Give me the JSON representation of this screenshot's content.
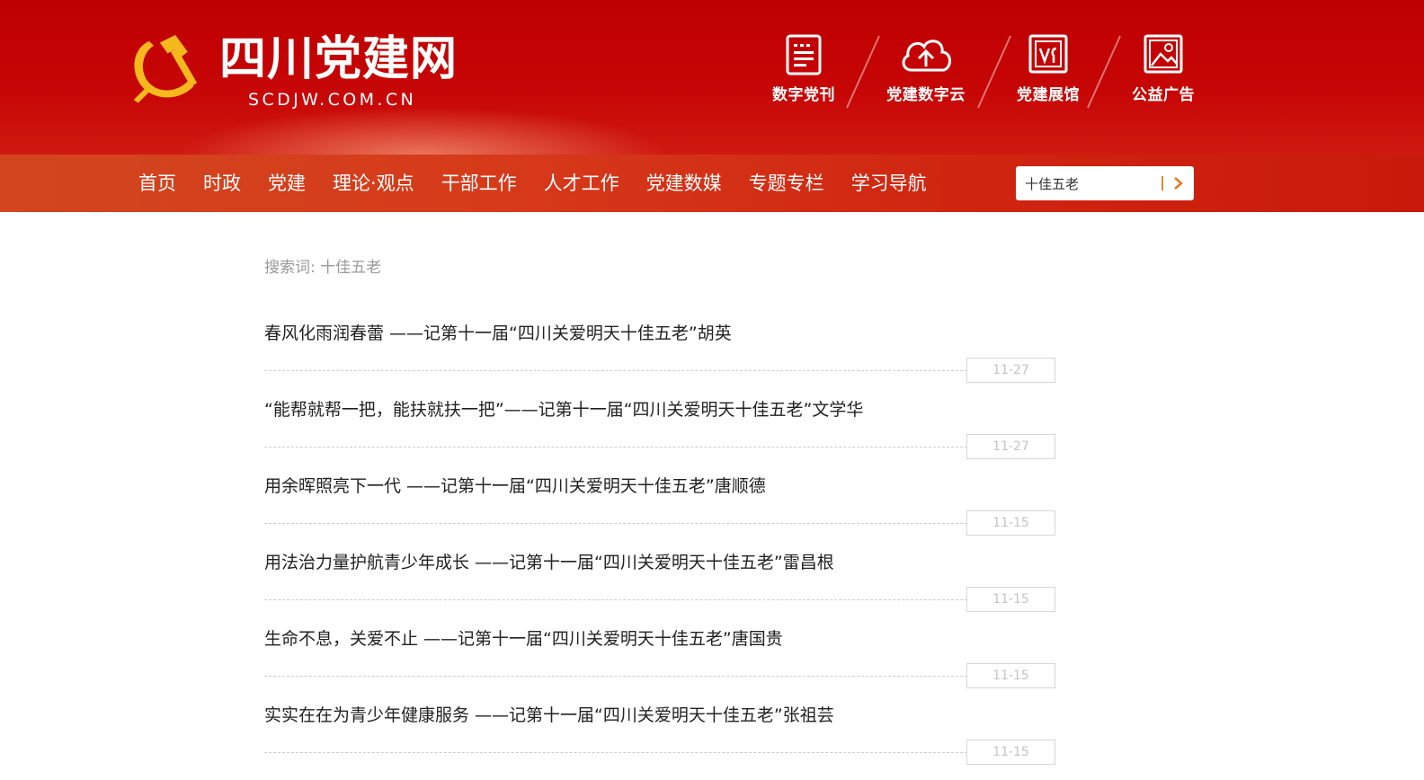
{
  "site": {
    "title_cn": "四川党建网",
    "title_en": "SCDJW.COM.CN"
  },
  "colors": {
    "header_red": "#c40404",
    "nav_orange_red": "#d43a1a",
    "emblem_gold": "#f5b91e",
    "date_text": "#c4c4c4"
  },
  "quick_links": [
    {
      "label": "数字党刊",
      "icon": "digital-journal-icon"
    },
    {
      "label": "党建数字云",
      "icon": "cloud-upload-icon"
    },
    {
      "label": "党建展馆",
      "icon": "exhibition-hall-icon"
    },
    {
      "label": "公益广告",
      "icon": "image-ad-icon"
    }
  ],
  "nav": {
    "items": [
      "首页",
      "时政",
      "党建",
      "理论·观点",
      "干部工作",
      "人才工作",
      "党建数媒",
      "专题专栏",
      "学习导航"
    ]
  },
  "search": {
    "value": "十佳五老",
    "button_icon": "chevron-right-icon"
  },
  "results": {
    "search_term_label": "搜索词: 十佳五老",
    "items": [
      {
        "title": "春风化雨润春蕾 ——记第十一届“四川关爱明天十佳五老”胡英",
        "date": "11-27"
      },
      {
        "title": "“能帮就帮一把，能扶就扶一把”——记第十一届“四川关爱明天十佳五老”文学华",
        "date": "11-27"
      },
      {
        "title": "用余晖照亮下一代 ——记第十一届“四川关爱明天十佳五老”唐顺德",
        "date": "11-15"
      },
      {
        "title": "用法治力量护航青少年成长 ——记第十一届“四川关爱明天十佳五老”雷昌根",
        "date": "11-15"
      },
      {
        "title": "生命不息，关爱不止 ——记第十一届“四川关爱明天十佳五老”唐国贵",
        "date": "11-15"
      },
      {
        "title": "实实在在为青少年健康服务 ——记第十一届“四川关爱明天十佳五老”张祖芸",
        "date": "11-15"
      }
    ]
  }
}
